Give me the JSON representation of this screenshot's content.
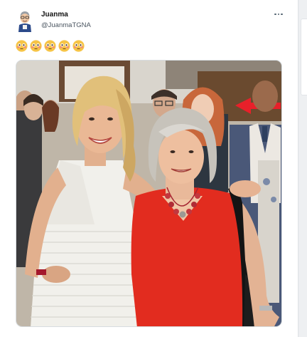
{
  "tweet": {
    "display_name": "Juanma",
    "handle": "@JuanmaTGNA",
    "emoji_text": "😳😳😳😳😳"
  },
  "icons": {
    "more": "more-horizontal-icon",
    "emoji": "flushed-face-emoji"
  },
  "colors": {
    "arrow": "#e8202a",
    "dress_red": "#e22c1f",
    "handle_grey": "#4a5560"
  }
}
